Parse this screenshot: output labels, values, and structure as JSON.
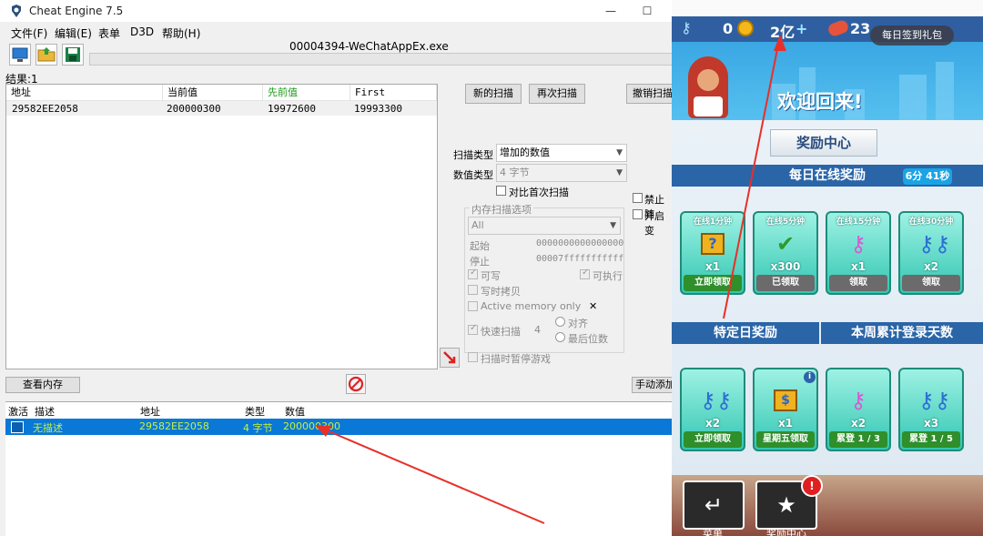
{
  "cheat_engine": {
    "window_title": "Cheat Engine 7.5",
    "window_controls": [
      "—",
      "☐"
    ],
    "menu": [
      "文件(F)",
      "编辑(E)",
      "表单",
      "D3D",
      "帮助(H)"
    ],
    "process_title": "00004394-WeChatAppEx.exe",
    "results_label": "结果:1",
    "found_list": {
      "headers": [
        "地址",
        "当前值",
        "先前值",
        "First"
      ],
      "rows": [
        {
          "address": "29582EE2058",
          "current": "200000300",
          "previous": "19972600",
          "first": "19993300"
        }
      ]
    },
    "buttons": {
      "new_scan": "新的扫描",
      "next_scan": "再次扫描",
      "undo_scan": "撤销扫描",
      "view_memory": "查看内存",
      "add_manually": "手动添加"
    },
    "scan_type_label": "扫描类型",
    "scan_type_value": "增加的数值",
    "value_type_label": "数值类型",
    "value_type_value": "4 字节",
    "compare_first_label": "对比首次扫描",
    "disable_label": "禁止随",
    "enable_label": "开启变",
    "memory_options": {
      "title": "内存扫描选项",
      "region": "All",
      "start_label": "起始",
      "start_value": "0000000000000000",
      "stop_label": "停止",
      "stop_value": "00007fffffffffff",
      "writable": "可写",
      "executable": "可执行",
      "copy_on_write": "写时拷贝",
      "active_memory": "Active memory only",
      "fast_scan": "快速扫描",
      "fast_scan_value": "4",
      "align": "对齐",
      "last_digits": "最后位数",
      "pause_game": "扫描时暂停游戏"
    },
    "address_list": {
      "headers": [
        "激活",
        "描述",
        "地址",
        "类型",
        "数值"
      ],
      "rows": [
        {
          "description": "无描述",
          "address": "29582EE2058",
          "type": "4 字节",
          "value": "200000300"
        }
      ]
    }
  },
  "game": {
    "currency": {
      "keys": "0",
      "coins": "2亿",
      "boards": "23"
    },
    "daily_signin_button": "每日签到礼包",
    "welcome_text": "欢迎回来!",
    "reward_center_tab": "奖励中心",
    "daily_online_title": "每日在线奖励",
    "timer": "6分 41秒",
    "online_rewards": [
      {
        "title": "在线1分钟",
        "icon": "mystery-box-icon",
        "qty": "x1",
        "button": "立即领取",
        "state": "green"
      },
      {
        "title": "在线5分钟",
        "icon": "hoverboard-icon",
        "qty": "x300",
        "button": "已领取",
        "state": "gray"
      },
      {
        "title": "在线15分钟",
        "icon": "key-icon",
        "qty": "x1",
        "button": "领取",
        "state": "gray"
      },
      {
        "title": "在线30分钟",
        "icon": "keys-icon",
        "qty": "x2",
        "button": "领取",
        "state": "gray"
      }
    ],
    "special_day_title": "特定日奖励",
    "weekly_login_title": "本周累计登录天数",
    "special_rewards": [
      {
        "icon": "keys-icon",
        "qty": "x2",
        "button": "立即领取"
      },
      {
        "icon": "mystery-box-icon",
        "qty": "x1",
        "button": "星期五领取"
      },
      {
        "icon": "key-icon",
        "qty": "x2",
        "button": "累登 1 / 3"
      },
      {
        "icon": "keys-icon",
        "qty": "x3",
        "button": "累登 1 / 5"
      }
    ],
    "bottom_buttons": [
      "菜单",
      "奖励中心"
    ]
  }
}
